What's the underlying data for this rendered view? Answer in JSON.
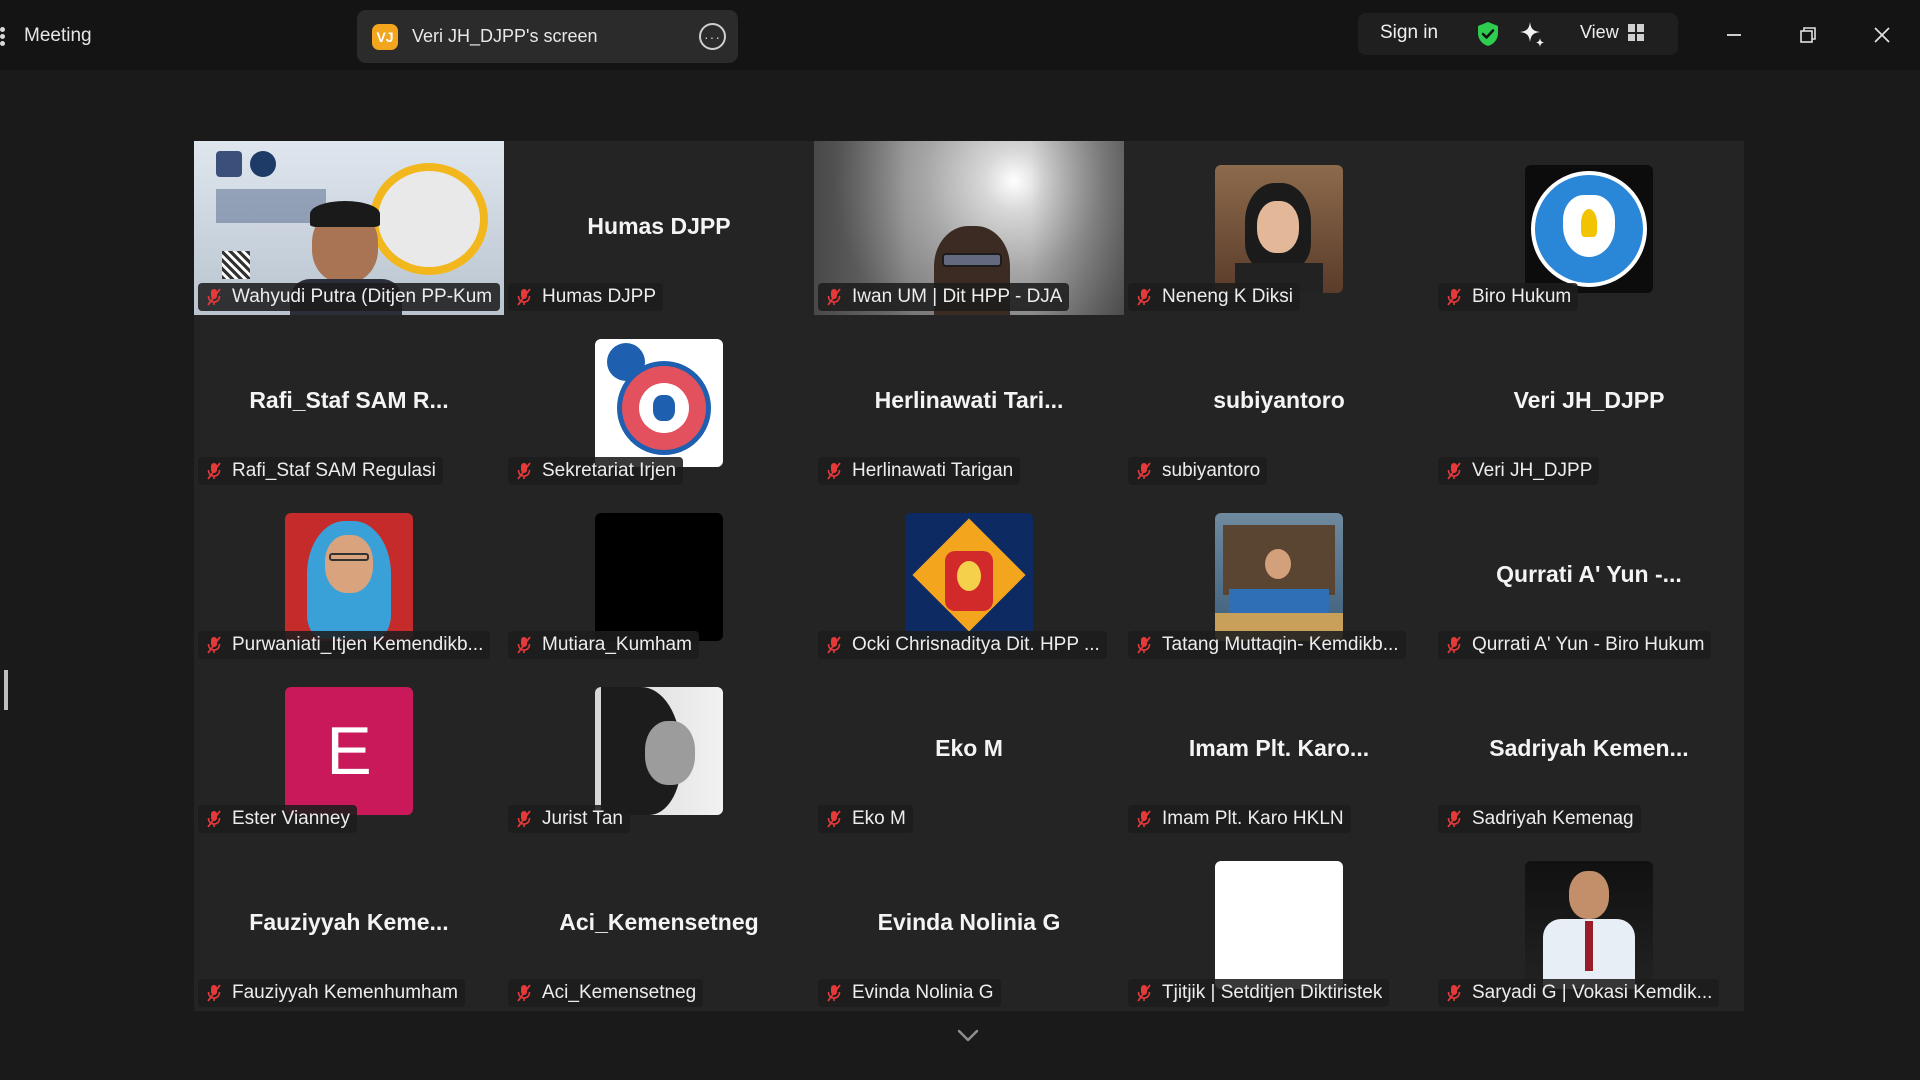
{
  "topbar": {
    "meeting_label": "Meeting",
    "share": {
      "badge": "VJ",
      "text": "Veri JH_DJPP's screen",
      "more_glyph": "···"
    },
    "sign_in": "Sign in",
    "view_label": "View",
    "colors": {
      "shield": "#2ecc4f",
      "badge": "#f3a51e"
    }
  },
  "participants": [
    {
      "name": "Wahyudi Putra (Ditjen PP-Kum...",
      "big": "",
      "kind": "video-wahyudi",
      "speaking": true
    },
    {
      "name": "Humas DJPP",
      "big": "Humas DJPP",
      "kind": "name"
    },
    {
      "name": "Iwan UM | Dit HPP - DJA",
      "big": "",
      "kind": "video-iwan"
    },
    {
      "name": "Neneng K Diksi",
      "big": "",
      "kind": "photo-neneng"
    },
    {
      "name": "Biro Hukum",
      "big": "",
      "kind": "logo-tutwuri"
    },
    {
      "name": "Rafi_Staf SAM Regulasi",
      "big": "Rafi_Staf SAM R...",
      "kind": "name"
    },
    {
      "name": "Sekretariat Irjen",
      "big": "",
      "kind": "logo-irjen"
    },
    {
      "name": "Herlinawati Tarigan",
      "big": "Herlinawati  Tari...",
      "kind": "name"
    },
    {
      "name": "subiyantoro",
      "big": "subiyantoro",
      "kind": "name"
    },
    {
      "name": "Veri JH_DJPP",
      "big": "Veri JH_DJPP",
      "kind": "name"
    },
    {
      "name": "Purwaniati_Itjen Kemendikb...",
      "big": "",
      "kind": "photo-purwaniati"
    },
    {
      "name": "Mutiara_Kumham",
      "big": "",
      "kind": "black"
    },
    {
      "name": "Ocki Chrisnaditya Dit. HPP ...",
      "big": "",
      "kind": "logo-garuda"
    },
    {
      "name": "Tatang Muttaqin- Kemdikb...",
      "big": "",
      "kind": "photo-tatang"
    },
    {
      "name": "Qurrati A' Yun - Biro Hukum",
      "big": "Qurrati A' Yun -...",
      "kind": "name"
    },
    {
      "name": "Ester Vianney",
      "big": "",
      "kind": "letter-e",
      "letter": "E"
    },
    {
      "name": "Jurist Tan",
      "big": "",
      "kind": "photo-jurist"
    },
    {
      "name": "Eko M",
      "big": "Eko M",
      "kind": "name"
    },
    {
      "name": "Imam Plt. Karo HKLN",
      "big": "Imam Plt. Karo...",
      "kind": "name"
    },
    {
      "name": "Sadriyah Kemenag",
      "big": "Sadriyah  Kemen...",
      "kind": "name"
    },
    {
      "name": "Fauziyyah Kemenhumham",
      "big": "Fauziyyah  Keme...",
      "kind": "name"
    },
    {
      "name": "Aci_Kemensetneg",
      "big": "Aci_Kemensetneg",
      "kind": "name"
    },
    {
      "name": "Evinda Nolinia G",
      "big": "Evinda Nolinia G",
      "kind": "name"
    },
    {
      "name": "Tjitjik | Setditjen Diktiristek",
      "big": "",
      "kind": "white"
    },
    {
      "name": "Saryadi G | Vokasi Kemdik...",
      "big": "",
      "kind": "photo-saryadi"
    }
  ],
  "icons": {
    "mic": "microphone-muted-icon",
    "chevron": "chevron-down-icon"
  }
}
